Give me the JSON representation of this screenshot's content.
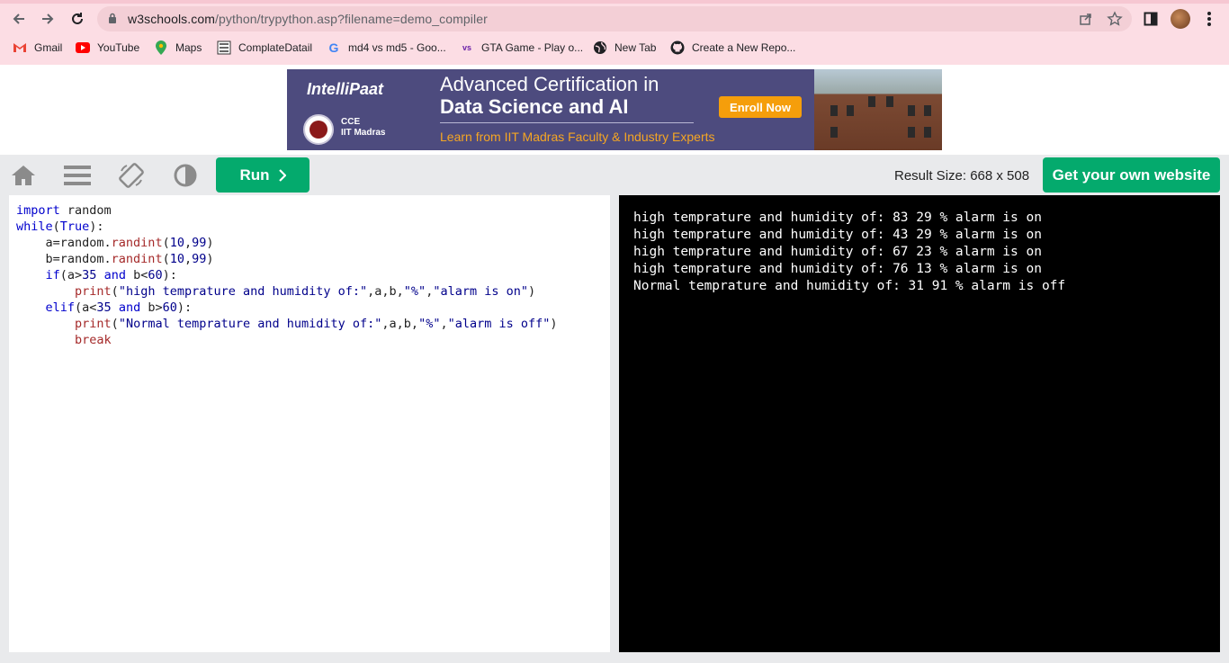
{
  "browser": {
    "url_host": "w3schools.com",
    "url_path": "/python/trypython.asp?filename=demo_compiler",
    "bookmarks": [
      {
        "label": "Gmail",
        "icon": "gmail-icon"
      },
      {
        "label": "YouTube",
        "icon": "youtube-icon"
      },
      {
        "label": "Maps",
        "icon": "maps-icon"
      },
      {
        "label": "ComplateDatail",
        "icon": "complate-icon"
      },
      {
        "label": "md4 vs md5 - Goo...",
        "icon": "google-icon"
      },
      {
        "label": "GTA Game - Play o...",
        "icon": "vs-icon"
      },
      {
        "label": "New Tab",
        "icon": "globe-icon"
      },
      {
        "label": "Create a New Repo...",
        "icon": "github-icon"
      }
    ]
  },
  "ad": {
    "brand": "IntelliPaat",
    "cce": "CCE",
    "iit": "IIT Madras",
    "headline1": "Advanced Certification in",
    "headline2": "Data Science and AI",
    "subline": "Learn from IIT Madras Faculty & Industry Experts",
    "cta": "Enroll Now"
  },
  "toolbar": {
    "run_label": "Run",
    "result_size": "Result Size: 668 x 508",
    "own_site_label": "Get your own website"
  },
  "code": {
    "lines": [
      "import random",
      "while(True):",
      "    a=random.randint(10,99)",
      "    b=random.randint(10,99)",
      "    if(a>35 and b<60):",
      "        print(\"high temprature and humidity of:\",a,b,\"%\",\"alarm is on\")",
      "    elif(a<35 and b>60):",
      "        print(\"Normal temprature and humidity of:\",a,b,\"%\",\"alarm is off\")",
      "        break"
    ]
  },
  "output": {
    "lines": [
      "high temprature and humidity of: 83 29 % alarm is on",
      "high temprature and humidity of: 43 29 % alarm is on",
      "high temprature and humidity of: 67 23 % alarm is on",
      "high temprature and humidity of: 76 13 % alarm is on",
      "Normal temprature and humidity of: 31 91 % alarm is off"
    ]
  },
  "colors": {
    "accent_green": "#04aa6d",
    "chrome_pink": "#fcdde4",
    "ad_purple": "#4d4b7e",
    "ad_orange": "#f59e0b"
  }
}
